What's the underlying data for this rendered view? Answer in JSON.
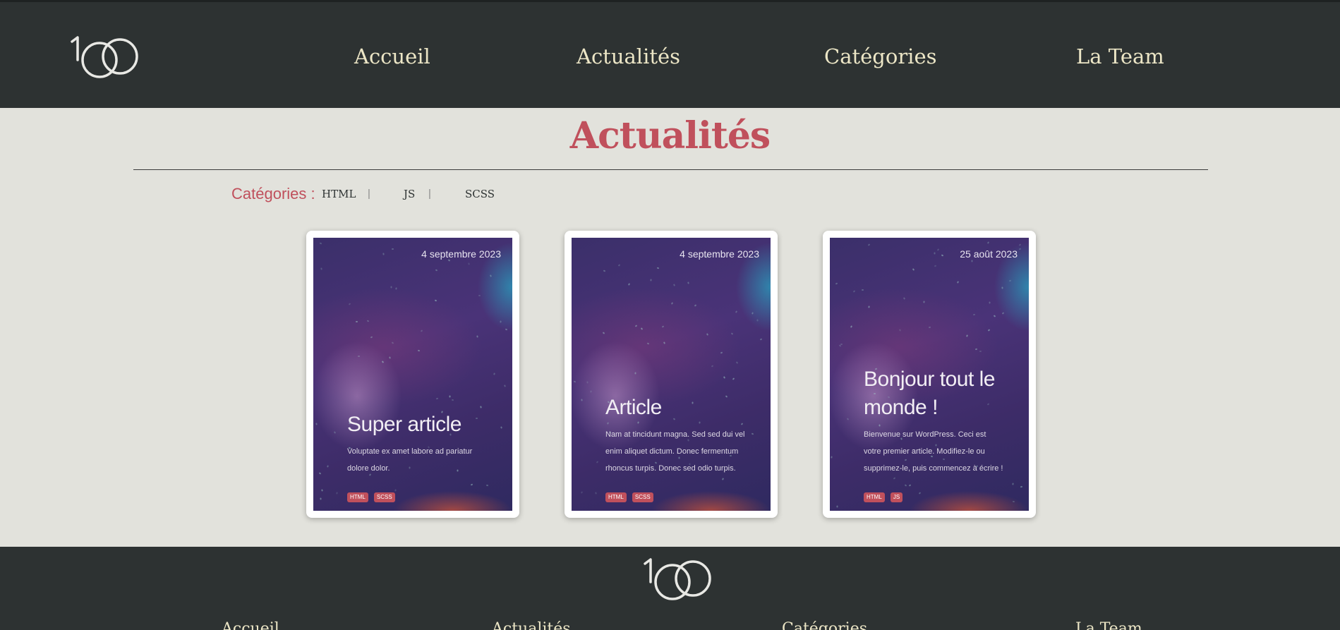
{
  "header": {
    "nav": [
      {
        "label": "Accueil"
      },
      {
        "label": "Actualités"
      },
      {
        "label": "Catégories"
      },
      {
        "label": "La Team"
      }
    ]
  },
  "main": {
    "title": "Actualités",
    "categories_label": "Catégories :",
    "categories": [
      {
        "label": "HTML"
      },
      {
        "label": "JS"
      },
      {
        "label": "SCSS"
      }
    ],
    "separator": "|",
    "cards": [
      {
        "date": "4 septembre 2023",
        "title": "Super article",
        "excerpt": "Voluptate ex amet labore ad pariatur dolore dolor.",
        "tags": [
          "HTML",
          "SCSS"
        ]
      },
      {
        "date": "4 septembre 2023",
        "title": "Article",
        "excerpt": "Nam at tincidunt magna. Sed sed dui vel enim aliquet dictum. Donec fermentum rhoncus turpis. Donec sed odio turpis.",
        "tags": [
          "HTML",
          "SCSS"
        ]
      },
      {
        "date": "25 août 2023",
        "title": "Bonjour tout le monde !",
        "excerpt": "Bienvenue sur WordPress. Ceci est votre premier article. Modifiez-le ou supprimez-le, puis commencez à écrire !",
        "tags": [
          "HTML",
          "JS"
        ]
      }
    ]
  },
  "footer": {
    "nav": [
      {
        "label": "Accueil"
      },
      {
        "label": "Actualités"
      },
      {
        "label": "Catégories"
      },
      {
        "label": "La Team"
      }
    ]
  },
  "colors": {
    "header_bg": "#2d3232",
    "page_bg": "#e2e2dc",
    "accent": "#c0505c",
    "nav_text": "#ece6c6"
  },
  "icons": {
    "logo": "1oo-logo-icon"
  }
}
